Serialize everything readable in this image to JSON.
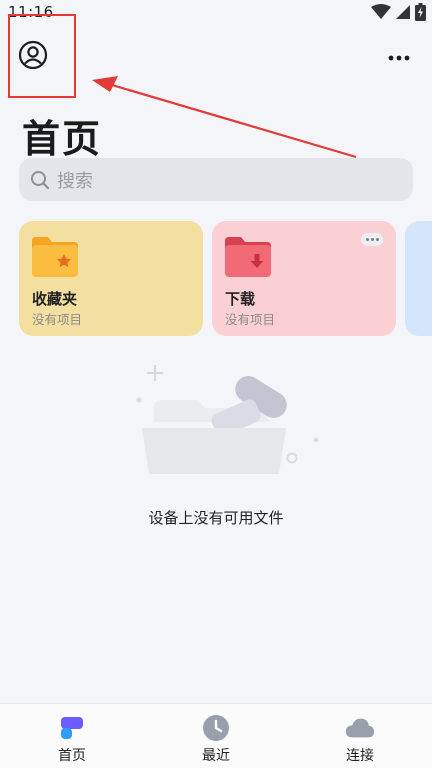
{
  "status_bar": {
    "time": "11:16",
    "icons": [
      "wifi-icon",
      "signal-icon",
      "battery-charging-icon"
    ]
  },
  "header": {
    "title": "首页",
    "profile_icon": "person-circle-icon",
    "more_icon": "more-horizontal-icon"
  },
  "search": {
    "placeholder": "搜索",
    "icon": "search-icon"
  },
  "cards": [
    {
      "title": "收藏夹",
      "subtitle": "没有项目",
      "icon": "favorites-folder-icon",
      "color": "#f3dfa0"
    },
    {
      "title": "下载",
      "subtitle": "没有项目",
      "icon": "downloads-folder-icon",
      "color": "#fbd0d4"
    }
  ],
  "empty_state": {
    "message": "设备上没有可用文件",
    "illustration": "empty-folder-illustration"
  },
  "bottom_nav": [
    {
      "label": "首页",
      "icon": "home-icon",
      "active": true
    },
    {
      "label": "最近",
      "icon": "clock-icon",
      "active": false
    },
    {
      "label": "连接",
      "icon": "cloud-icon",
      "active": false
    }
  ],
  "colors": {
    "background": "#f4f5f9",
    "highlight": "#e53935",
    "nav_active": "#6a5cff"
  }
}
